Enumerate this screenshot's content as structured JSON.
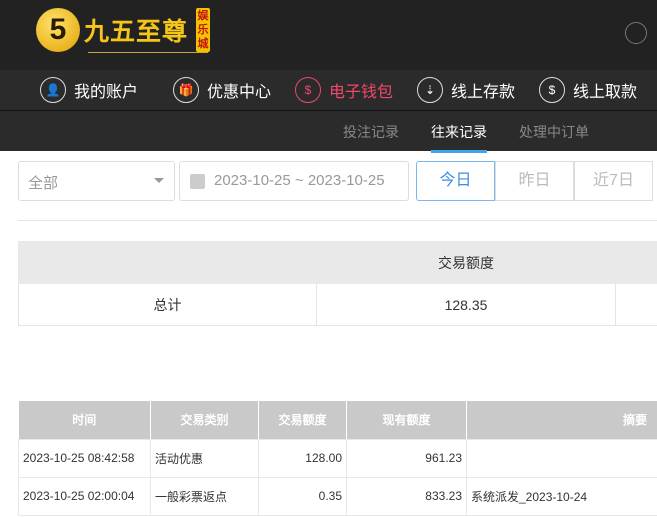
{
  "logo": {
    "name": "九五至尊",
    "badge": "娱乐城",
    "mark": "5"
  },
  "nav": [
    {
      "label": "我的账户",
      "icon": "user-icon"
    },
    {
      "label": "优惠中心",
      "icon": "gift-icon"
    },
    {
      "label": "电子钱包",
      "icon": "wallet-icon",
      "active": true
    },
    {
      "label": "线上存款",
      "icon": "deposit-icon"
    },
    {
      "label": "线上取款",
      "icon": "withdraw-icon"
    }
  ],
  "subtabs": [
    {
      "label": "投注记录"
    },
    {
      "label": "往来记录",
      "active": true
    },
    {
      "label": "处理中订单"
    }
  ],
  "filter": {
    "type": "全部",
    "date_range": "2023-10-25 ~ 2023-10-25",
    "quick": [
      "今日",
      "昨日",
      "近7日"
    ]
  },
  "summary": {
    "header": "交易额度",
    "label": "总计",
    "value": "128.35"
  },
  "table": {
    "columns": [
      "时间",
      "交易类别",
      "交易额度",
      "现有额度",
      "摘要"
    ],
    "rows": [
      [
        "2023-10-25 08:42:58",
        "活动优惠",
        "128.00",
        "961.23",
        ""
      ],
      [
        "2023-10-25 02:00:04",
        "一般彩票返点",
        "0.35",
        "833.23",
        "系统派发_2023-10-24"
      ]
    ]
  }
}
